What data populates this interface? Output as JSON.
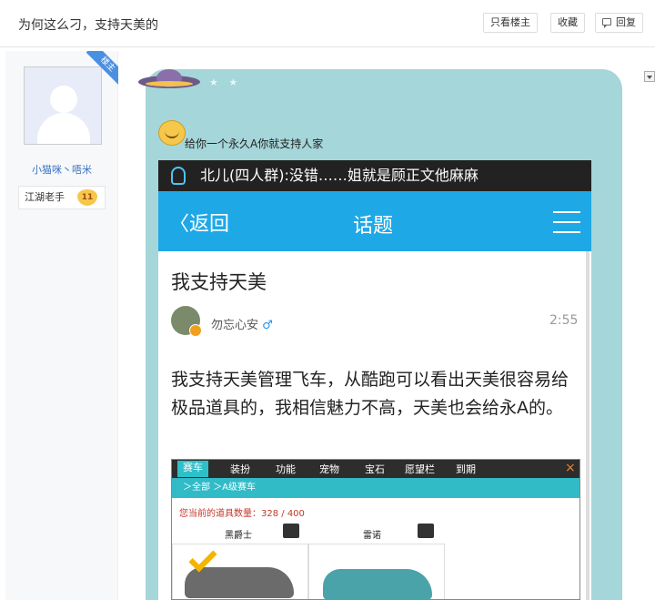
{
  "header": {
    "title": "为何这么刁，支持天美的",
    "only_op_label": "只看楼主",
    "favorite_label": "收藏",
    "reply_label": "回复"
  },
  "author": {
    "ribbon": "楼主",
    "name": "小猫咪丶唔米",
    "rank": "江湖老手",
    "level": "11"
  },
  "post": {
    "text": "给你一个永久A你就支持人家"
  },
  "screenshot": {
    "notification": "北儿(四人群):没错……姐就是顾正文他麻麻",
    "back_label": "返回",
    "nav_title": "话题",
    "topic_title": "我支持天美",
    "poster_name": "勿忘心安",
    "poster_gender": "♂",
    "time": "2:55",
    "body": "我支持天美管理飞车，从酷跑可以看出天美很容易给极品道具的，我相信魅力不高，天美也会给永A的。",
    "game": {
      "tabs": [
        "赛车",
        "装扮",
        "功能",
        "宠物",
        "宝石",
        "愿望栏",
        "到期"
      ],
      "breadcrumb": "＞全部  ＞A级赛车",
      "count": "您当前的道具数量：328 / 400",
      "car1": "黑爵士",
      "car2": "雷诺",
      "close": "×"
    }
  }
}
